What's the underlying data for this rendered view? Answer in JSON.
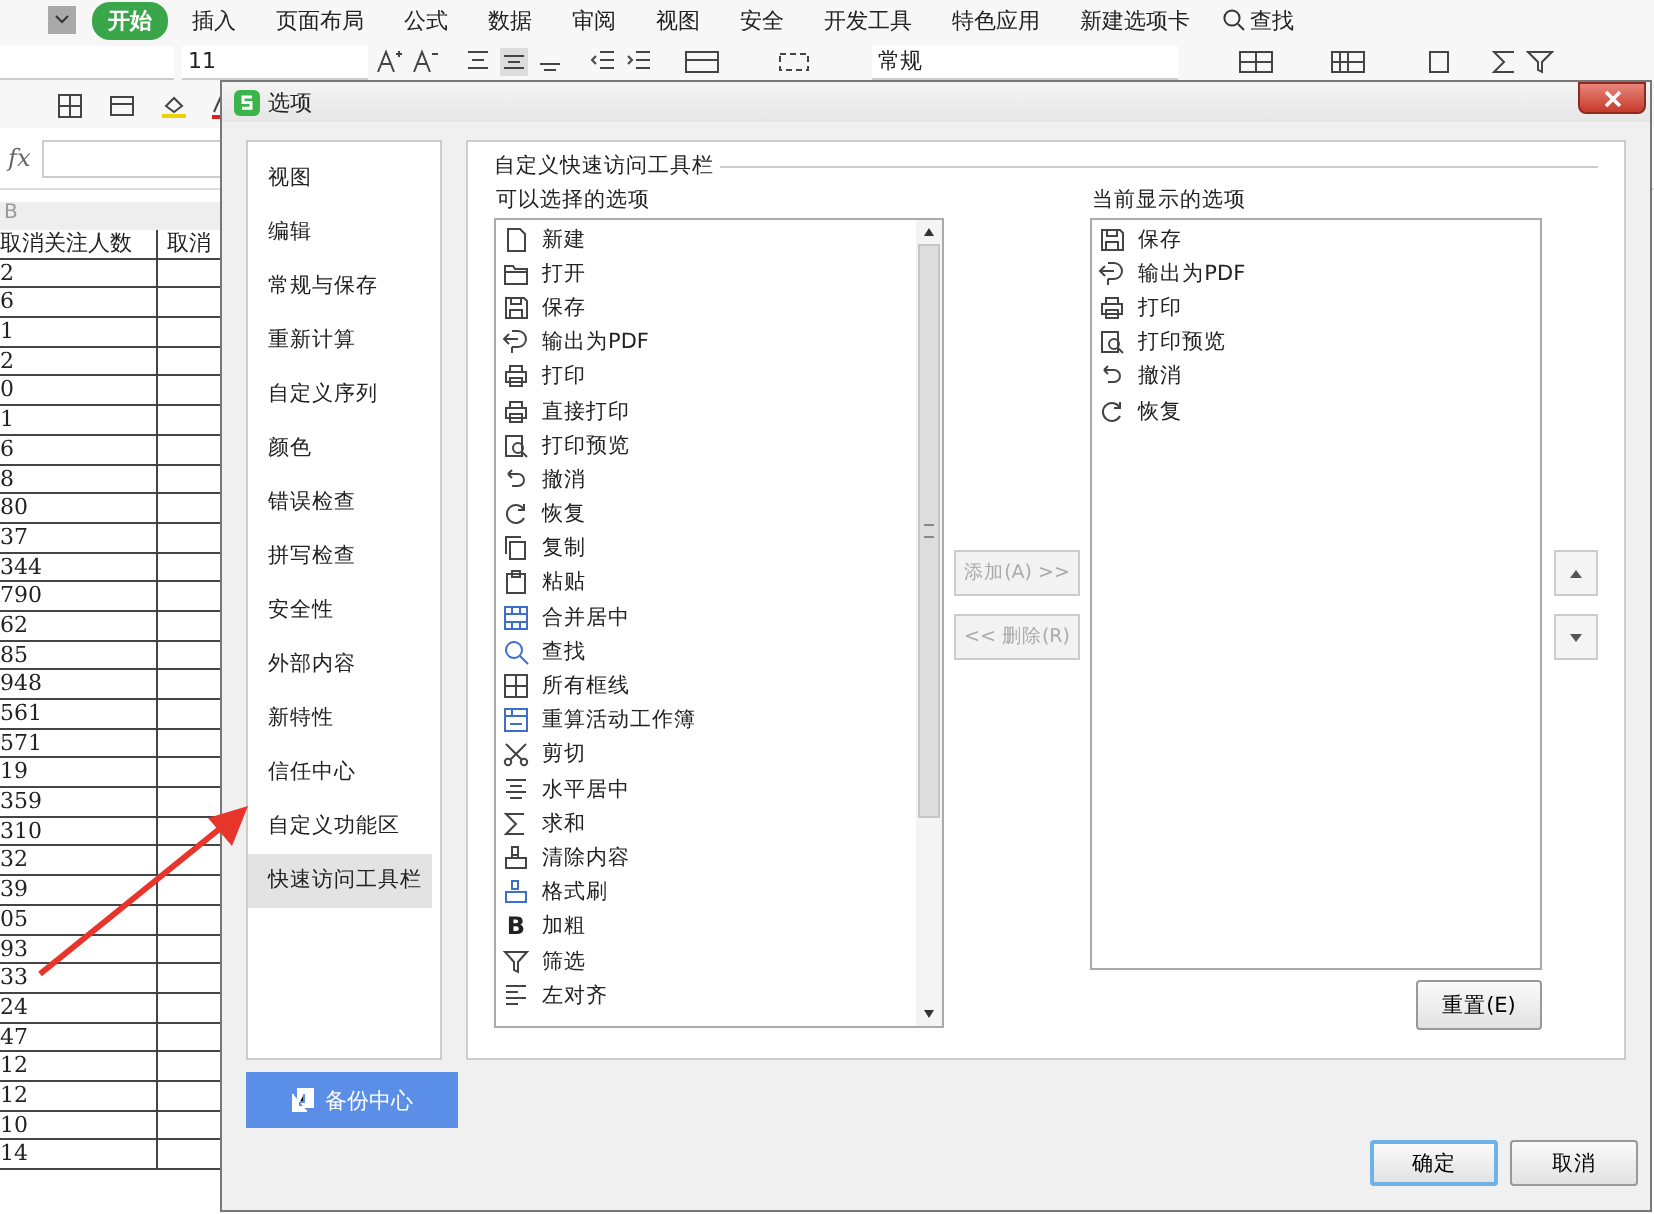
{
  "ribbon": {
    "tabs": [
      {
        "label": "开始",
        "selected": true
      },
      {
        "label": "插入",
        "selected": false
      },
      {
        "label": "页面布局",
        "selected": false
      },
      {
        "label": "公式",
        "selected": false
      },
      {
        "label": "数据",
        "selected": false
      },
      {
        "label": "审阅",
        "selected": false
      },
      {
        "label": "视图",
        "selected": false
      },
      {
        "label": "安全",
        "selected": false
      },
      {
        "label": "开发工具",
        "selected": false
      },
      {
        "label": "特色应用",
        "selected": false
      },
      {
        "label": "新建选项卡",
        "selected": false
      }
    ],
    "search": "查找",
    "font_size": "11",
    "number_format": "常规"
  },
  "formula_bar": {
    "label": "fx"
  },
  "sheet": {
    "column_header": "B",
    "columns": [
      "取消关注人数",
      "取消"
    ],
    "rows": [
      "2",
      "6",
      "1",
      "2",
      "0",
      "1",
      "6",
      "8",
      "80",
      "37",
      "344",
      "790",
      "62",
      "85",
      "948",
      "561",
      "571",
      "19",
      "359",
      "310",
      "32",
      "39",
      "05",
      "93",
      "33",
      "24",
      "47",
      "12",
      "12",
      "10",
      "14"
    ]
  },
  "dialog": {
    "title": "选项",
    "nav": [
      {
        "label": "视图",
        "selected": false
      },
      {
        "label": "编辑",
        "selected": false
      },
      {
        "label": "常规与保存",
        "selected": false
      },
      {
        "label": "重新计算",
        "selected": false
      },
      {
        "label": "自定义序列",
        "selected": false
      },
      {
        "label": "颜色",
        "selected": false
      },
      {
        "label": "错误检查",
        "selected": false
      },
      {
        "label": "拼写检查",
        "selected": false
      },
      {
        "label": "安全性",
        "selected": false
      },
      {
        "label": "外部内容",
        "selected": false
      },
      {
        "label": "新特性",
        "selected": false
      },
      {
        "label": "信任中心",
        "selected": false
      },
      {
        "label": "自定义功能区",
        "selected": false
      },
      {
        "label": "快速访问工具栏",
        "selected": true
      }
    ],
    "backup_button": "备份中心",
    "group_title": "自定义快速访问工具栏",
    "available_label": "可以选择的选项",
    "available": [
      {
        "label": "新建"
      },
      {
        "label": "打开"
      },
      {
        "label": "保存"
      },
      {
        "label": "输出为PDF"
      },
      {
        "label": "打印"
      },
      {
        "label": "直接打印"
      },
      {
        "label": "打印预览"
      },
      {
        "label": "撤消"
      },
      {
        "label": "恢复"
      },
      {
        "label": "复制"
      },
      {
        "label": "粘贴"
      },
      {
        "label": "合并居中"
      },
      {
        "label": "查找"
      },
      {
        "label": "所有框线"
      },
      {
        "label": "重算活动工作簿"
      },
      {
        "label": "剪切"
      },
      {
        "label": "水平居中"
      },
      {
        "label": "求和"
      },
      {
        "label": "清除内容"
      },
      {
        "label": "格式刷"
      },
      {
        "label": "加粗",
        "icon_text": "B"
      },
      {
        "label": "筛选"
      },
      {
        "label": "左对齐"
      }
    ],
    "add_button": {
      "label": "添加(A) >>",
      "disabled": true
    },
    "remove_button": {
      "label": "<< 删除(R)",
      "disabled": true
    },
    "current_label": "当前显示的选项",
    "current": [
      {
        "label": "保存"
      },
      {
        "label": "输出为PDF"
      },
      {
        "label": "打印"
      },
      {
        "label": "打印预览"
      },
      {
        "label": "撤消"
      },
      {
        "label": "恢复"
      }
    ],
    "reset_button": "重置(E)",
    "ok_button": "确定",
    "cancel_button": "取消"
  }
}
